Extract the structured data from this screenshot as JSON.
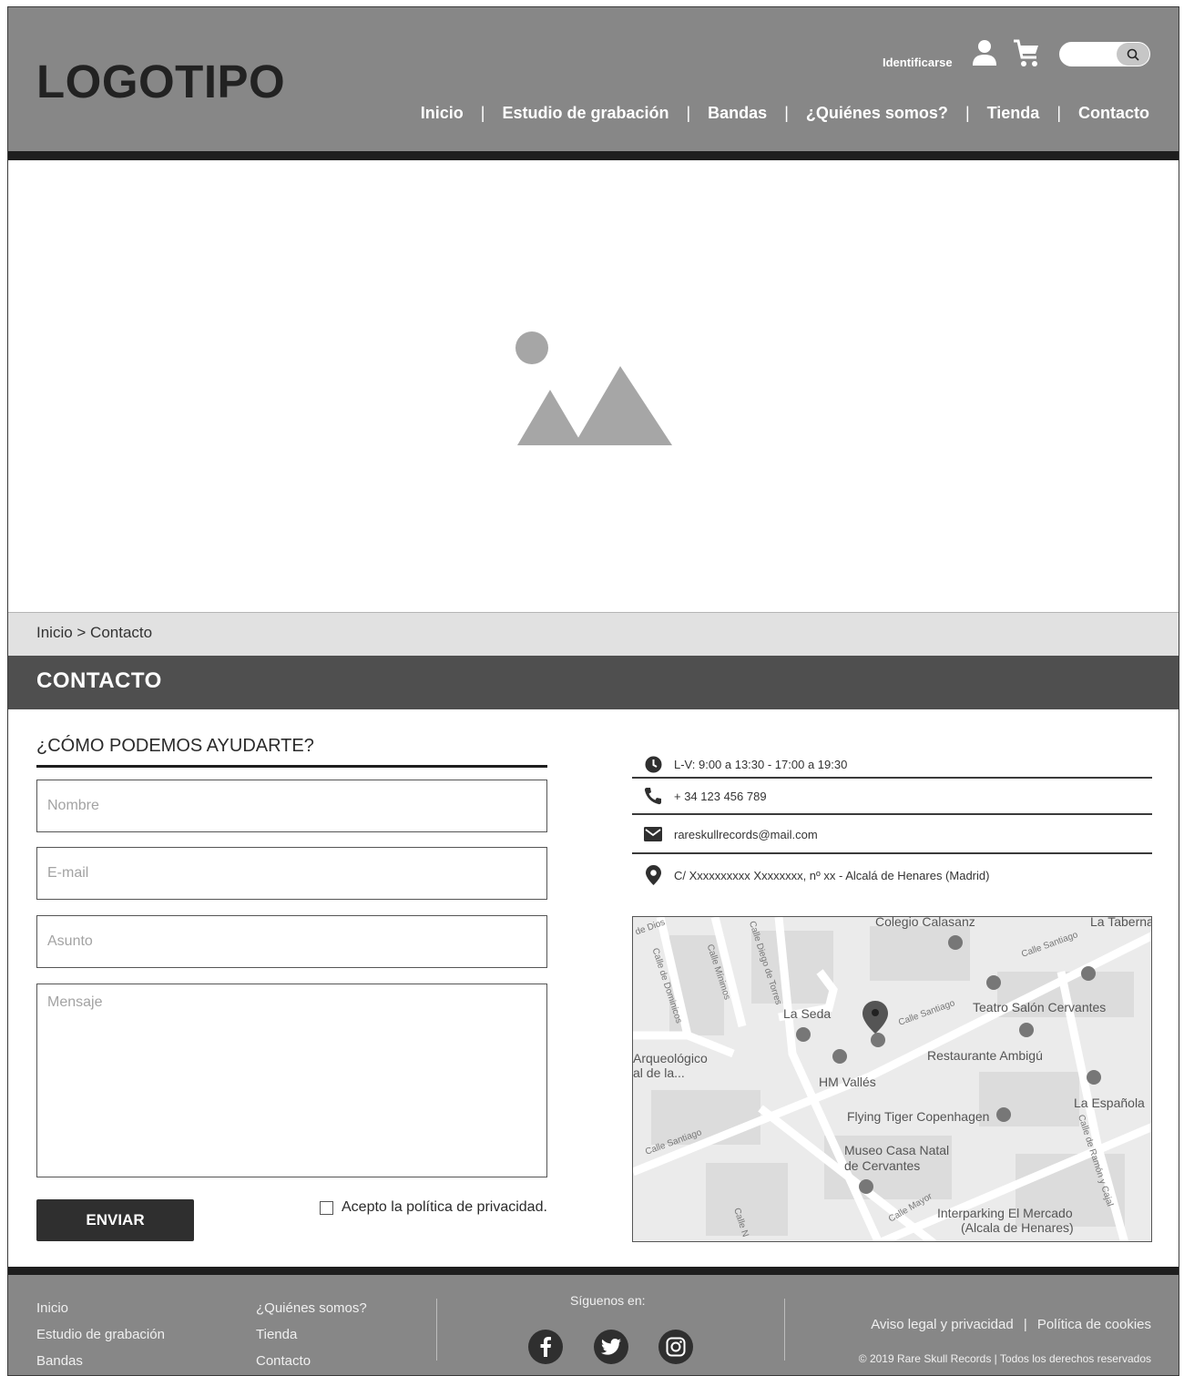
{
  "header": {
    "logo": "LOGOTIPO",
    "login_label": "Identificarse",
    "search_placeholder": "",
    "nav": [
      "Inicio",
      "Estudio de grabación",
      "Bandas",
      "¿Quiénes somos?",
      "Tienda",
      "Contacto"
    ],
    "nav_separator": "|"
  },
  "breadcrumb": "Inicio > Contacto",
  "page_title": "CONTACTO",
  "form": {
    "heading": "¿CÓMO PODEMOS AYUDARTE?",
    "name_placeholder": "Nombre",
    "email_placeholder": "E-mail",
    "subject_placeholder": "Asunto",
    "message_placeholder": "Mensaje",
    "submit_label": "ENVIAR",
    "privacy_label": "Acepto la política de privacidad."
  },
  "contact": {
    "hours": "L-V: 9:00 a 13:30 - 17:00 a 19:30",
    "phone": "+ 34 123 456 789",
    "email": "rareskullrecords@mail.com",
    "address": "C/ Xxxxxxxxxx Xxxxxxxx, nº xx - Alcalá de Henares (Madrid)"
  },
  "map": {
    "places": {
      "colegio": "Colegio Calasanz",
      "taberna": "La Taberna",
      "la_seda": "La Seda",
      "teatro": "Teatro Salón Cervantes",
      "restaurante": "Restaurante Ambigú",
      "arqueologico_1": "Arqueológico",
      "arqueologico_2": "al de la...",
      "hm_valles": "HM Vallés",
      "flying_tiger": "Flying Tiger Copenhagen",
      "la_espanola": "La Española",
      "museo_1": "Museo Casa Natal",
      "museo_2": "de Cervantes",
      "interparking_1": "Interparking El Mercado",
      "interparking_2": "(Alcala de Henares)"
    },
    "streets": {
      "de_dios": "de Dios",
      "dominicos": "Calle de Dominicos",
      "minimos": "Calle Mínimos",
      "diego": "Calle Diego de Torres",
      "santiago_1": "Calle Santiago",
      "santiago_2": "Calle Santiago",
      "santiago_3": "Calle Santiago",
      "ramon": "Calle de Ramón y Cajal",
      "mayor": "Calle Mayor",
      "calle_n": "Calle N"
    }
  },
  "footer": {
    "col1": [
      "Inicio",
      "Estudio de grabación",
      "Bandas"
    ],
    "col2": [
      "¿Quiénes somos?",
      "Tienda",
      "Contacto"
    ],
    "follow_label": "Síguenos en:",
    "social": [
      "facebook-icon",
      "twitter-icon",
      "instagram-icon"
    ],
    "legal_1": "Aviso legal y privacidad",
    "legal_sep": "|",
    "legal_2": "Política de cookies",
    "copyright": "© 2019 Rare Skull Records | Todos los derechos reservados"
  }
}
